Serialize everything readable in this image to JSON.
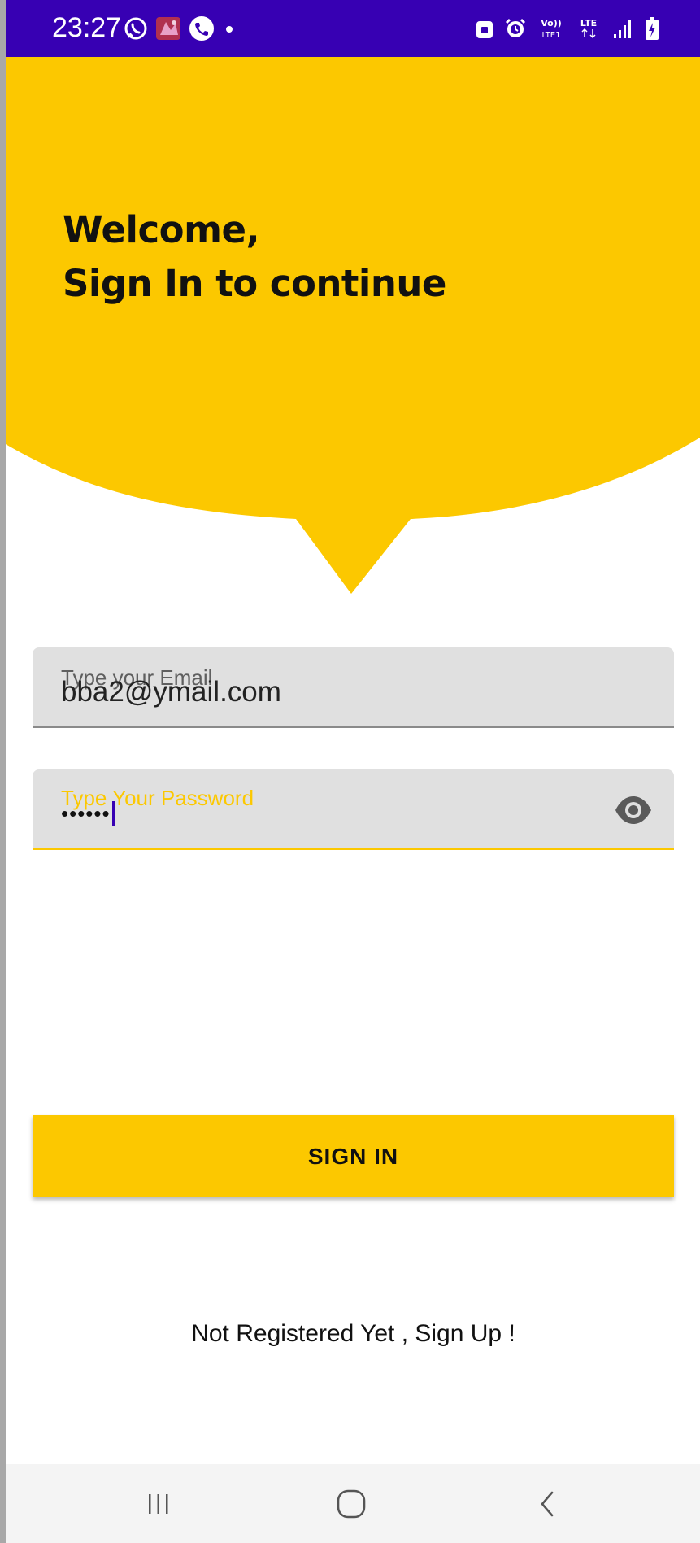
{
  "status_bar": {
    "time": "23:27",
    "left_icons": [
      "whatsapp-icon",
      "app-notification-icon",
      "phone-call-icon",
      "dot-icon"
    ],
    "right_icons": [
      "lock-icon",
      "alarm-icon",
      "volte-icon",
      "lte-icon",
      "signal-icon",
      "battery-icon"
    ],
    "volte_text": "Vo))",
    "lte1_text": "LTE1",
    "lte_text": "LTE",
    "background_color": "#3700b3"
  },
  "header": {
    "welcome_line1": "Welcome,",
    "welcome_line2": "Sign In to continue",
    "background_color": "#fcc800"
  },
  "form": {
    "email_label": "Type your Email",
    "email_value": "bba2@ymail.com",
    "password_label": "Type Your Password",
    "password_masked": "••••••",
    "visibility_icon": "eye-icon"
  },
  "actions": {
    "sign_in_label": "SIGN IN",
    "sign_up_link": "Not Registered Yet , Sign Up !",
    "accent_color": "#fcc800"
  },
  "nav_bar": {
    "buttons": [
      "recent-apps-icon",
      "home-icon",
      "back-icon"
    ]
  }
}
